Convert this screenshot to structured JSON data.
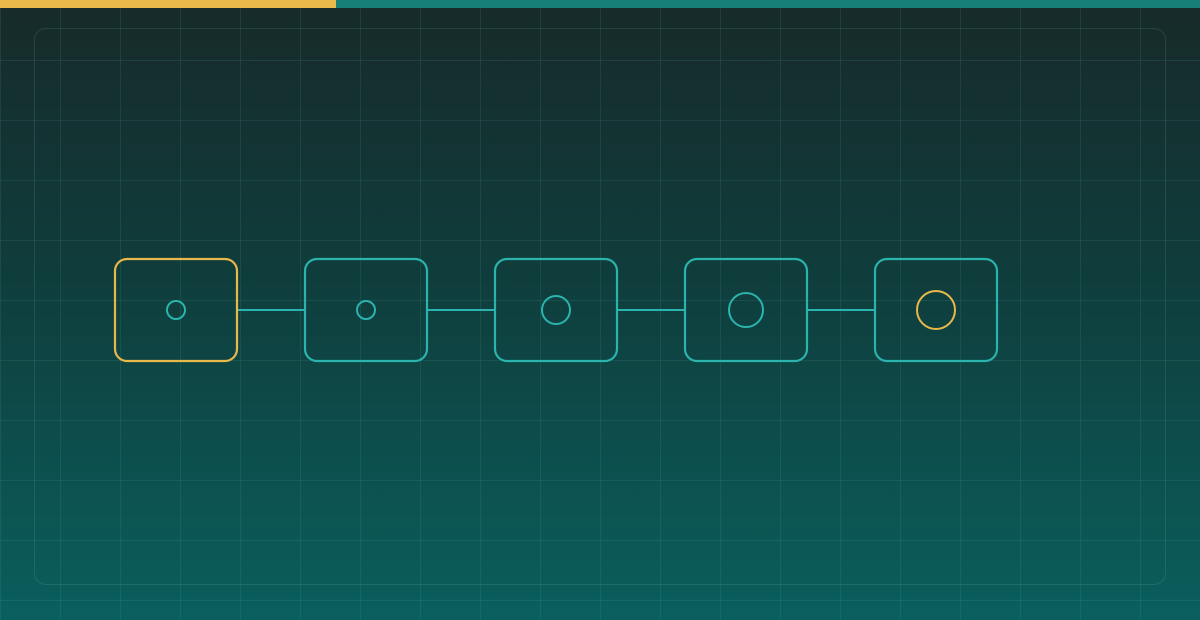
{
  "progress": {
    "fraction": 0.28,
    "fill_color": "#e8b84a",
    "track_color": "#177f77"
  },
  "colors": {
    "accent": "#e8b84a",
    "primary": "#2bb3ad"
  },
  "steps": [
    {
      "icon": "circle-icon",
      "active": true,
      "ring": "small"
    },
    {
      "icon": "circle-icon",
      "active": false,
      "ring": "small"
    },
    {
      "icon": "circle-icon",
      "active": false,
      "ring": "medium"
    },
    {
      "icon": "circle-icon",
      "active": false,
      "ring": "large"
    },
    {
      "icon": "circle-icon",
      "active": false,
      "ring": "large",
      "ring_accent": true
    }
  ]
}
